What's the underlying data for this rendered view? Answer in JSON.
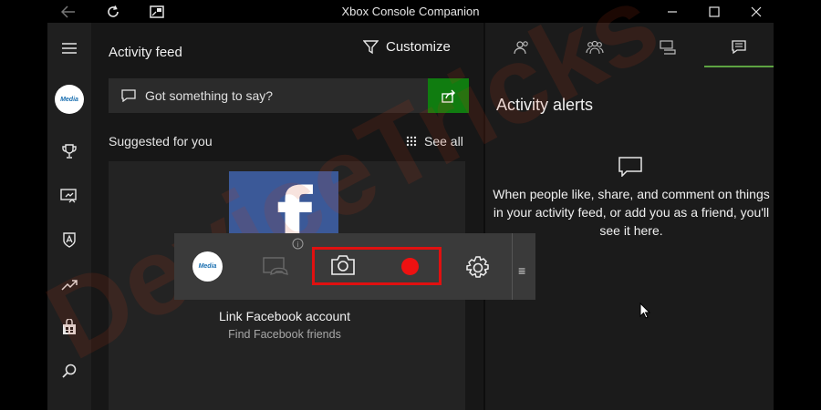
{
  "window": {
    "title": "Xbox Console Companion"
  },
  "feed": {
    "title": "Activity feed",
    "customize_label": "Customize",
    "say_placeholder": "Got something to say?",
    "suggested_label": "Suggested for you",
    "see_all_label": "See all",
    "card": {
      "logo_letter": "f",
      "link_label": "Link Facebook account",
      "sub_label": "Find Facebook friends"
    }
  },
  "alerts": {
    "title": "Activity alerts",
    "message": "When people like, share, and comment on things in your activity feed, or add you as a friend, you'll see it here."
  },
  "gamebar": {
    "avatar_text": "Media",
    "info_glyph": "i",
    "menu_glyph": "≡"
  },
  "watermark": {
    "text": "DeviceTricks"
  },
  "colors": {
    "accent_green": "#107c10",
    "tab_underline": "#5ea342",
    "record_red": "#ee1111",
    "highlight_red": "#e01010",
    "facebook_blue": "#3b5998"
  },
  "icons": {
    "titlebar": [
      "back-arrow-icon",
      "refresh-icon",
      "snap-icon",
      "minimize-icon",
      "maximize-icon",
      "close-icon"
    ],
    "rail": [
      "hamburger-menu-icon",
      "trophy-icon",
      "game-dvr-icon",
      "achievement-shield-icon",
      "trending-icon",
      "store-icon",
      "search-icon"
    ],
    "right_tabs": [
      "friends-icon",
      "party-icon",
      "messages-icon",
      "activity-alerts-icon"
    ],
    "gamebar": [
      "xbox-controller-icon",
      "camera-icon",
      "record-icon",
      "gear-icon"
    ]
  }
}
